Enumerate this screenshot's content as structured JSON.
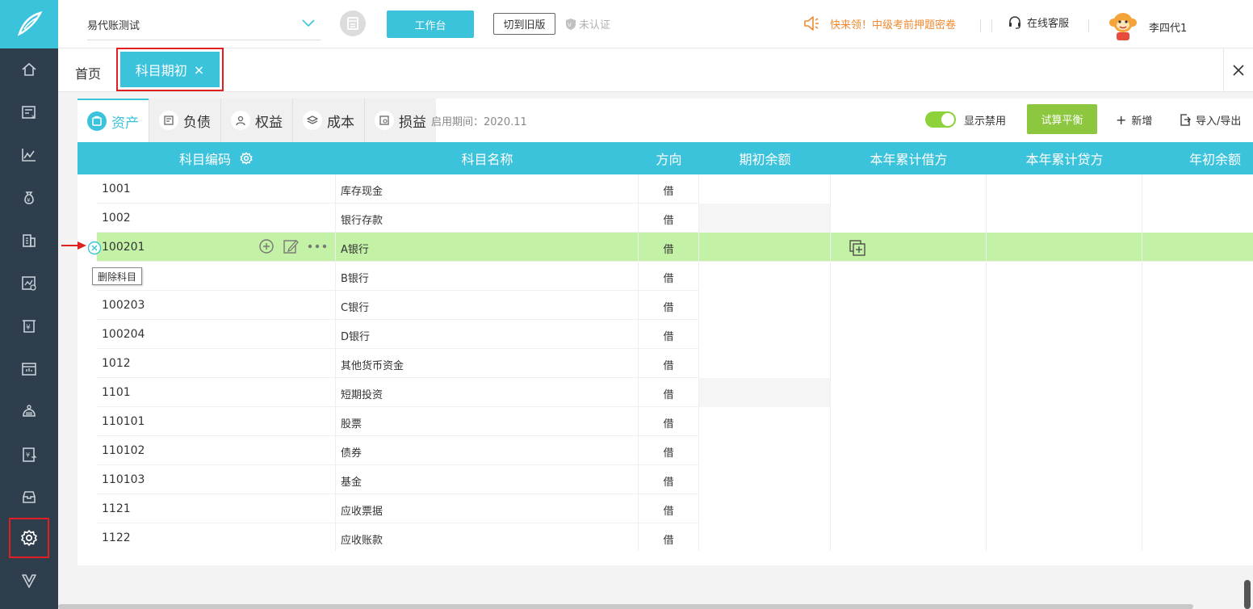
{
  "topbar": {
    "company": "易代账测试",
    "workbench_label": "工作台",
    "old_version_label": "切到旧版",
    "uncertified_label": "未认证",
    "promo_text": "快来领！中级考前押题密卷",
    "service_label": "在线客服",
    "username": "李四代1"
  },
  "tabs": {
    "home": "首页",
    "active": "科目期初",
    "close_glyph": "×"
  },
  "categories": [
    "资产",
    "负债",
    "权益",
    "成本",
    "损益"
  ],
  "period_label": "启用期间：2020.11",
  "toolbar": {
    "show_disabled": "显示禁用",
    "trial_balance": "试算平衡",
    "add": "新增",
    "import_export": "导入/导出",
    "plus_glyph": "+"
  },
  "table": {
    "headers": [
      "科目编码",
      "科目名称",
      "方向",
      "期初余额",
      "本年累计借方",
      "本年累计贷方",
      "年初余额"
    ],
    "rows": [
      {
        "code": "1001",
        "name": "库存现金",
        "dir": "借"
      },
      {
        "code": "1002",
        "name": "银行存款",
        "dir": "借"
      },
      {
        "code": "100201",
        "name": "A银行",
        "dir": "借"
      },
      {
        "code": "",
        "name": "B银行",
        "dir": "借"
      },
      {
        "code": "100203",
        "name": "C银行",
        "dir": "借"
      },
      {
        "code": "100204",
        "name": "D银行",
        "dir": "借"
      },
      {
        "code": "1012",
        "name": "其他货币资金",
        "dir": "借"
      },
      {
        "code": "1101",
        "name": "短期投资",
        "dir": "借"
      },
      {
        "code": "110101",
        "name": "股票",
        "dir": "借"
      },
      {
        "code": "110102",
        "name": "债券",
        "dir": "借"
      },
      {
        "code": "110103",
        "name": "基金",
        "dir": "借"
      },
      {
        "code": "1121",
        "name": "应收票据",
        "dir": "借"
      },
      {
        "code": "1122",
        "name": "应收账款",
        "dir": "借"
      }
    ]
  },
  "tooltip": "删除科目",
  "colors": {
    "brand": "#3cc3dc",
    "sidebar": "#2f3e4c",
    "selected_row": "#c3f2a6",
    "trial_button": "#8dc63f",
    "highlight": "#e02020"
  }
}
